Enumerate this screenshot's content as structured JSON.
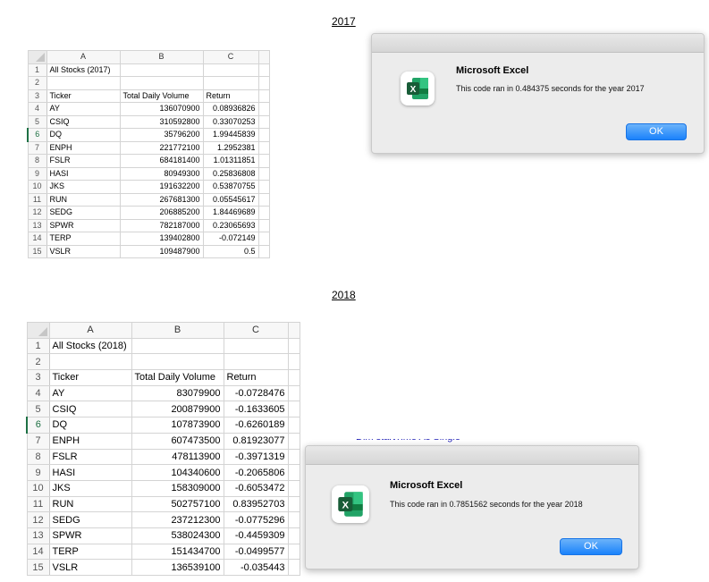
{
  "title_2017": "2017",
  "title_2018": "2018",
  "columns": [
    "A",
    "B",
    "C"
  ],
  "sheet_2017": {
    "rows": [
      [
        "1",
        "All Stocks (2017)",
        "",
        ""
      ],
      [
        "2",
        "",
        "",
        ""
      ],
      [
        "3",
        "Ticker",
        "Total Daily Volume",
        "Return"
      ],
      [
        "4",
        "AY",
        "136070900",
        "0.08936826"
      ],
      [
        "5",
        "CSIQ",
        "310592800",
        "0.33070253"
      ],
      [
        "6",
        "DQ",
        "35796200",
        "1.99445839"
      ],
      [
        "7",
        "ENPH",
        "221772100",
        "1.2952381"
      ],
      [
        "8",
        "FSLR",
        "684181400",
        "1.01311851"
      ],
      [
        "9",
        "HASI",
        "80949300",
        "0.25836808"
      ],
      [
        "10",
        "JKS",
        "191632200",
        "0.53870755"
      ],
      [
        "11",
        "RUN",
        "267681300",
        "0.05545617"
      ],
      [
        "12",
        "SEDG",
        "206885200",
        "1.84469689"
      ],
      [
        "13",
        "SPWR",
        "782187000",
        "0.23065693"
      ],
      [
        "14",
        "TERP",
        "139402800",
        "-0.072149"
      ],
      [
        "15",
        "VSLR",
        "109487900",
        "0.5"
      ]
    ]
  },
  "sheet_2018": {
    "rows": [
      [
        "1",
        "All Stocks (2018)",
        "",
        ""
      ],
      [
        "2",
        "",
        "",
        ""
      ],
      [
        "3",
        "Ticker",
        "Total Daily Volume",
        "Return"
      ],
      [
        "4",
        "AY",
        "83079900",
        "-0.0728476"
      ],
      [
        "5",
        "CSIQ",
        "200879900",
        "-0.1633605"
      ],
      [
        "6",
        "DQ",
        "107873900",
        "-0.6260189"
      ],
      [
        "7",
        "ENPH",
        "607473500",
        "0.81923077"
      ],
      [
        "8",
        "FSLR",
        "478113900",
        "-0.3971319"
      ],
      [
        "9",
        "HASI",
        "104340600",
        "-0.2065806"
      ],
      [
        "10",
        "JKS",
        "158309000",
        "-0.6053472"
      ],
      [
        "11",
        "RUN",
        "502757100",
        "0.83952703"
      ],
      [
        "12",
        "SEDG",
        "237212300",
        "-0.0775296"
      ],
      [
        "13",
        "SPWR",
        "538024300",
        "-0.4459309"
      ],
      [
        "14",
        "TERP",
        "151434700",
        "-0.0499577"
      ],
      [
        "15",
        "VSLR",
        "136539100",
        "-0.035443"
      ]
    ]
  },
  "dialog_2017": {
    "title": "Microsoft Excel",
    "message": "This code ran in 0.484375 seconds for the year 2017",
    "ok_label": "OK",
    "icon": "excel-app-icon"
  },
  "dialog_2018": {
    "title": "Microsoft Excel",
    "message": "This code ran in 0.7851562 seconds for the year 2018",
    "ok_label": "OK",
    "icon": "excel-app-icon"
  },
  "colors": {
    "excel_green": "#1e7145",
    "ok_button_blue": "#1a82fb",
    "dialog_bg": "#ececec"
  }
}
